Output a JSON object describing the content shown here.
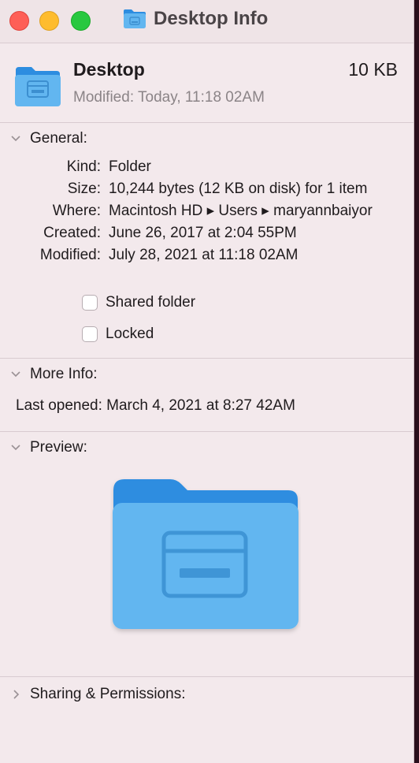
{
  "window": {
    "title": "Desktop Info"
  },
  "header": {
    "name": "Desktop",
    "size": "10 KB",
    "modified": "Modified: Today, 11:18 02AM"
  },
  "general": {
    "label": "General:",
    "rows": [
      {
        "key": "Kind:",
        "value": "Folder"
      },
      {
        "key": "Size:",
        "value": "10,244 bytes (12 KB on disk) for 1 item"
      },
      {
        "key": "Where:",
        "value": "Macintosh HD ▸ Users ▸ maryannbaiyor"
      },
      {
        "key": "Created:",
        "value": "June 26, 2017 at 2:04 55PM"
      },
      {
        "key": "Modified:",
        "value": "July 28, 2021 at 11:18 02AM"
      }
    ],
    "shared_folder": "Shared folder",
    "locked": "Locked"
  },
  "more_info": {
    "label": "More Info:",
    "last_opened": "Last opened: March 4, 2021 at 8:27 42AM"
  },
  "preview": {
    "label": "Preview:"
  },
  "sharing": {
    "label": "Sharing & Permissions:"
  },
  "icons": {
    "folder": "desktop-folder-icon",
    "chevron_down": "chevron-down-icon",
    "chevron_right": "chevron-right-icon"
  },
  "colors": {
    "folder_front": "#62b6f0",
    "folder_back": "#2d8de0",
    "window_bg": "#f3e9ec"
  }
}
